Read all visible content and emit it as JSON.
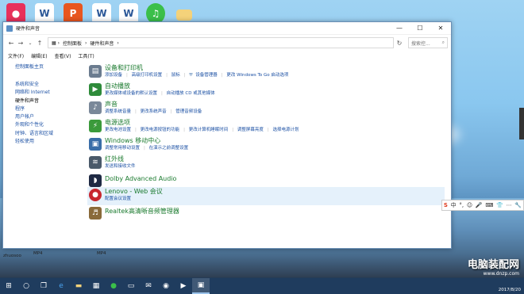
{
  "desktop": {
    "icons": [
      "camera-app-icon",
      "word-document-icon",
      "wps-presentation-icon",
      "word-document-icon",
      "word-document-icon",
      "music-app-icon",
      "folder-icon",
      "file-icon"
    ],
    "bottom_labels": [
      "zhuosoo",
      "MP4",
      "MP4"
    ]
  },
  "window": {
    "title": "硬件和声音",
    "controls": {
      "minimize": "—",
      "maximize": "☐",
      "close": "✕"
    }
  },
  "address": {
    "breadcrumb": [
      "控制面板",
      "硬件和声音"
    ],
    "search_placeholder": "搜索控..."
  },
  "menu": [
    "文件(F)",
    "编辑(E)",
    "查看(V)",
    "工具(T)"
  ],
  "left_nav": {
    "home": "控制面板主页",
    "items": [
      {
        "label": "系统和安全",
        "active": false
      },
      {
        "label": "网络和 Internet",
        "active": false
      },
      {
        "label": "硬件和声音",
        "active": true
      },
      {
        "label": "程序",
        "active": false
      },
      {
        "label": "用户帐户",
        "active": false
      },
      {
        "label": "外观和个性化",
        "active": false
      },
      {
        "label": "时钟、语言和区域",
        "active": false
      },
      {
        "label": "轻松使用",
        "active": false
      }
    ]
  },
  "categories": [
    {
      "title": "设备和打印机",
      "icon_color": "#6b7c8f",
      "links": [
        "添加设备",
        "高级打印机设置",
        "鼠标",
        "设备管理器",
        "更改 Windows To Go 启动选项"
      ]
    },
    {
      "title": "自动播放",
      "icon_color": "#2e8b3a",
      "links": [
        "更改媒体或设备的默认设置",
        "自动播放 CD 或其他媒体"
      ]
    },
    {
      "title": "声音",
      "icon_color": "#7a8899",
      "links": [
        "调整系统音量",
        "更改系统声音",
        "管理音频设备"
      ]
    },
    {
      "title": "电源选项",
      "icon_color": "#3b9a3b",
      "links": [
        "更改电池设置",
        "更改电源按钮的功能",
        "更改计算机睡眠时间",
        "调整屏幕亮度",
        "选择电源计划"
      ]
    },
    {
      "title": "Windows 移动中心",
      "icon_color": "#3a6ea8",
      "links": [
        "调整常用移动设置",
        "在演示之前调整设置"
      ]
    },
    {
      "title": "红外线",
      "icon_color": "#4a5a6a",
      "links": [
        "发送和接收文件"
      ]
    },
    {
      "title": "Dolby Advanced Audio",
      "icon_color": "#1f2a44",
      "links": []
    },
    {
      "title": "Lenovo - Web 会议",
      "icon_color": "#c8262e",
      "links": [
        "配置会议设置"
      ]
    },
    {
      "title": "Realtek高清晰音频管理器",
      "icon_color": "#8a6a3a",
      "links": []
    }
  ],
  "taskbar": {
    "time_date": "2017/8/20"
  },
  "watermark": {
    "title": "电脑装配网",
    "url": "www.dnzp.com"
  },
  "ime": {
    "brand": "S",
    "items": [
      "中",
      "°,",
      "☺",
      "🎤",
      "⌨",
      "👕",
      "⋯",
      "🔧"
    ]
  }
}
